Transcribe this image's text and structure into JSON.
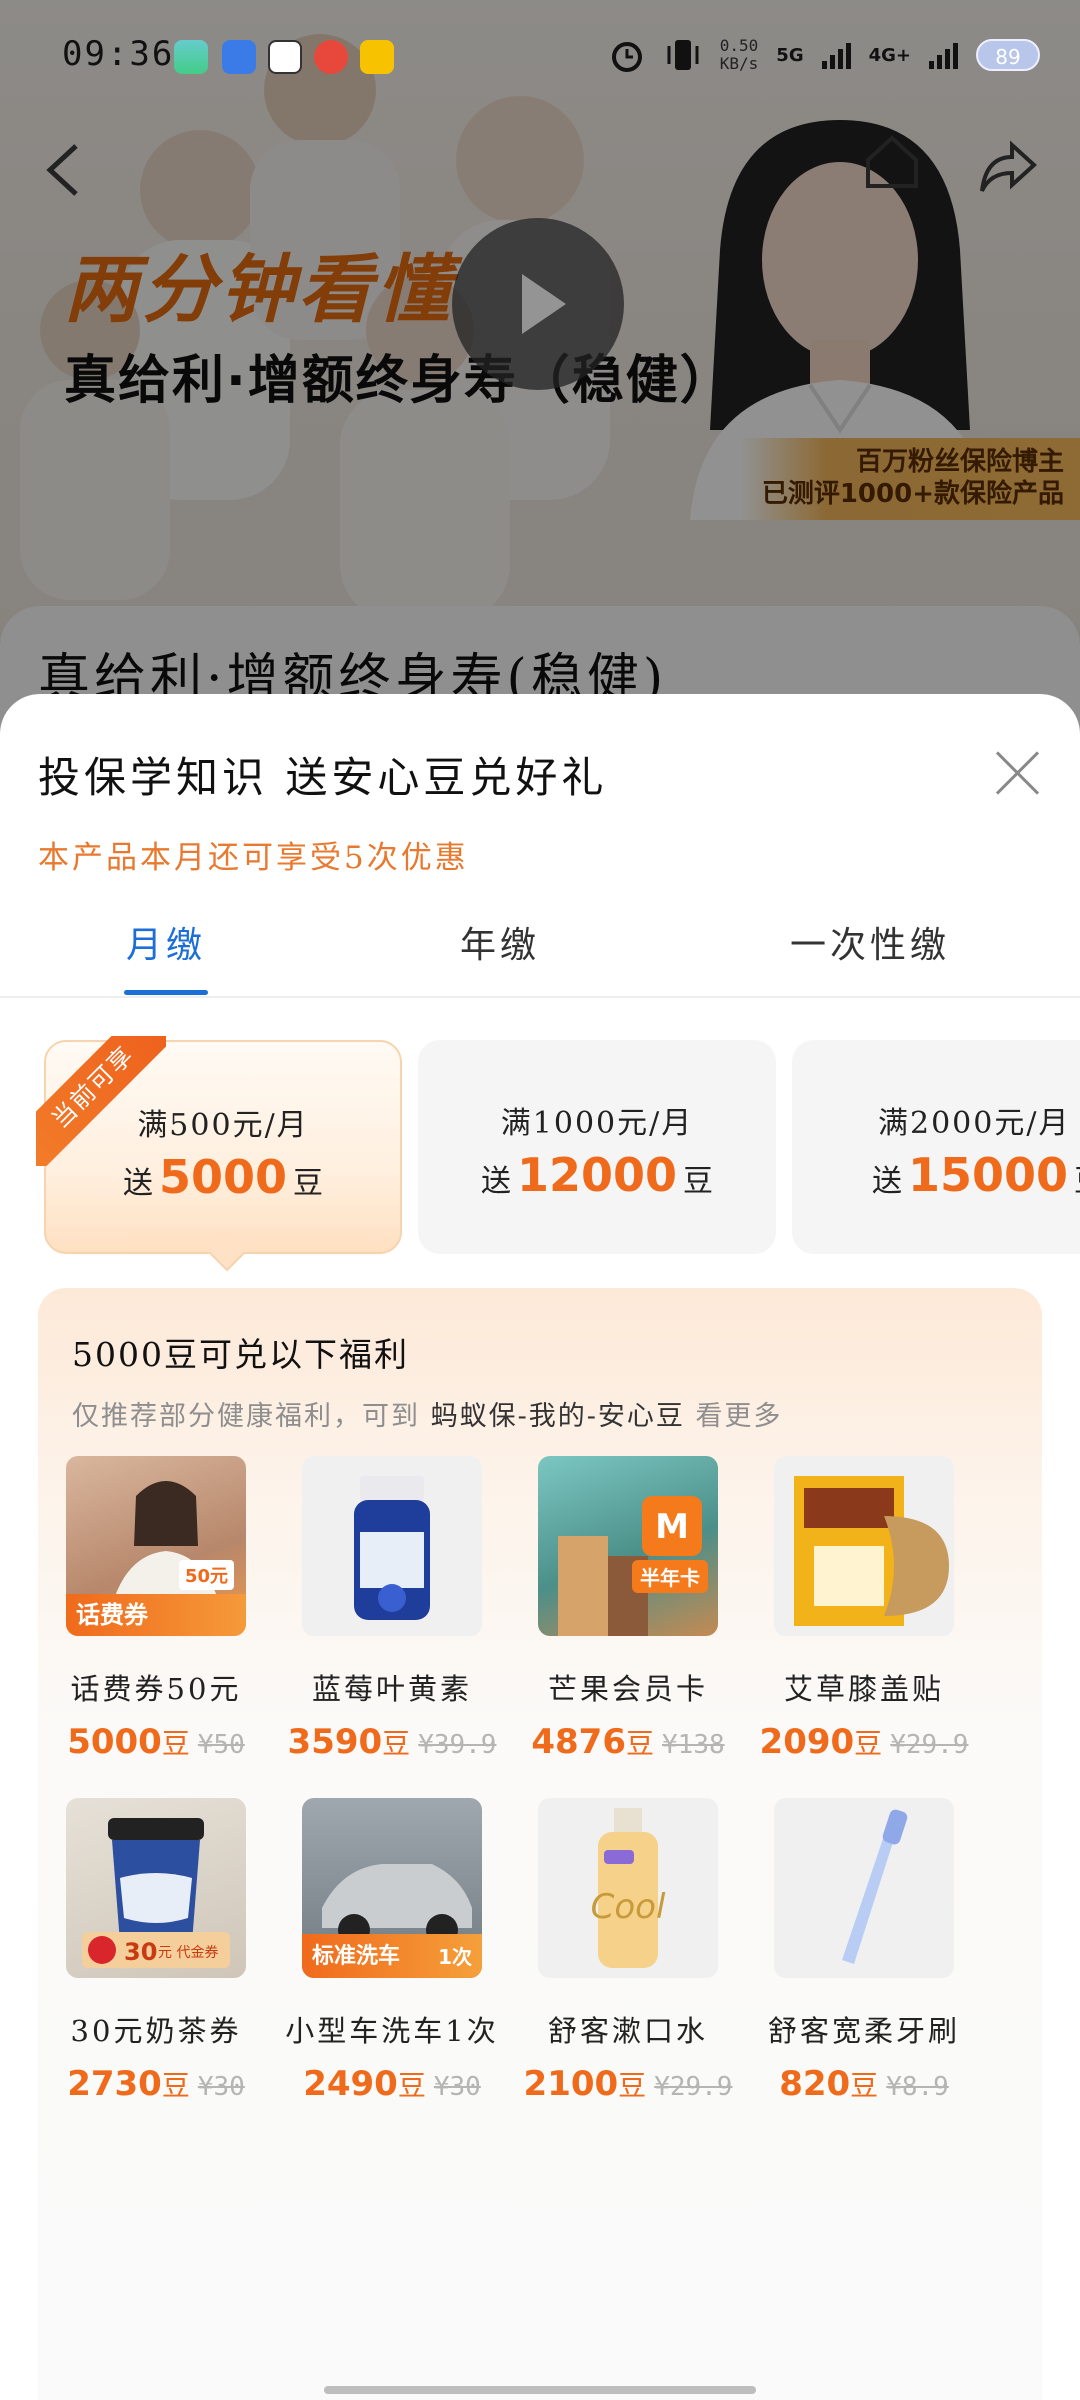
{
  "status_bar": {
    "time": "09:36",
    "speed_value": "0.50",
    "speed_unit": "KB/s",
    "net1": "5G",
    "net2": "4G+",
    "battery": "89"
  },
  "hero": {
    "title_line1": "两分钟看懂",
    "title_line2": "真给利·增额终身寿（稳健）",
    "badge_line1": "百万粉丝保险博主",
    "badge_line2": "已测评1000+款保险产品"
  },
  "product": {
    "title": "真给利·增额终身寿(稳健)"
  },
  "sheet": {
    "title": "投保学知识 送安心豆兑好礼",
    "subtitle": "本产品本月还可享受5次优惠",
    "tabs": [
      {
        "label": "月缴",
        "active": true
      },
      {
        "label": "年缴",
        "active": false
      },
      {
        "label": "一次性缴",
        "active": false
      }
    ],
    "ribbon": "当前可享",
    "tiers": [
      {
        "condition": "满500元/月",
        "prefix": "送",
        "amount": "5000",
        "suffix": "豆",
        "active": true
      },
      {
        "condition": "满1000元/月",
        "prefix": "送",
        "amount": "12000",
        "suffix": "豆",
        "active": false
      },
      {
        "condition": "满2000元/月",
        "prefix": "送",
        "amount": "15000",
        "suffix": "豆",
        "active": false
      }
    ],
    "benefits": {
      "title": "5000豆可兑以下福利",
      "subtitle_prefix": "仅推荐部分健康福利，可到",
      "subtitle_path": "蚂蚁保-我的-安心豆",
      "subtitle_suffix": "看更多",
      "items": [
        {
          "name": "话费券50元",
          "points": "5000",
          "unit": "豆",
          "original": "¥50",
          "thumb_tag": "话费券",
          "thumb_tag2": "50元"
        },
        {
          "name": "蓝莓叶黄素",
          "points": "3590",
          "unit": "豆",
          "original": "¥39.9"
        },
        {
          "name": "芒果会员卡",
          "points": "4876",
          "unit": "豆",
          "original": "¥138",
          "thumb_tag": "半年卡"
        },
        {
          "name": "艾草膝盖贴",
          "points": "2090",
          "unit": "豆",
          "original": "¥29.9"
        },
        {
          "name": "30元奶茶券",
          "points": "2730",
          "unit": "豆",
          "original": "¥30",
          "thumb_tag": "30",
          "thumb_tag2": "元 代金券"
        },
        {
          "name": "小型车洗车1次",
          "points": "2490",
          "unit": "豆",
          "original": "¥30",
          "thumb_tag": "标准洗车",
          "thumb_tag2": "1次"
        },
        {
          "name": "舒客漱口水",
          "points": "2100",
          "unit": "豆",
          "original": "¥29.9"
        },
        {
          "name": "舒客宽柔牙刷",
          "points": "820",
          "unit": "豆",
          "original": "¥8.9"
        }
      ]
    }
  },
  "colors": {
    "accent_blue": "#1b6fd6",
    "accent_orange": "#f06a1c",
    "subtitle_orange": "#e8792f"
  }
}
